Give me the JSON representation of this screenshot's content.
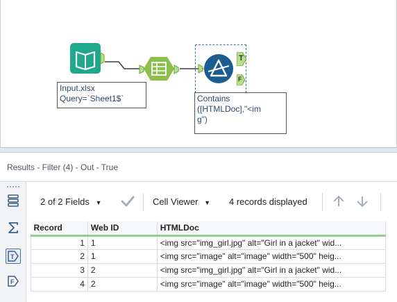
{
  "canvas": {
    "input_tool": {
      "icon": "book-input-icon",
      "annotation_line1": "Input.xlsx",
      "annotation_line2": "Query=`Sheet1$`"
    },
    "select_tool": {
      "icon": "table-select-icon"
    },
    "filter_tool": {
      "icon": "filter-triangle-icon",
      "true_anchor": "T",
      "false_anchor": "F",
      "annotation_line1": "Contains",
      "annotation_line2": "([HTMLDoc],\"<im",
      "annotation_line3": "g\")"
    }
  },
  "results": {
    "title": "Results - Filter (4) - Out - True",
    "toolbar": {
      "fields_label": "2 of 2 Fields",
      "viewer_label": "Cell Viewer",
      "records_label": "4 records displayed"
    },
    "rail": [
      "fields-list-icon",
      "sum-icon",
      "true-anchor-icon",
      "false-anchor-icon"
    ],
    "columns": [
      "Record",
      "Web ID",
      "HTMLDoc"
    ],
    "rows": [
      {
        "record": "1",
        "web_id": "1",
        "html": "<img src=\"img_girl.jpg\" alt=\"Girl in a jacket\" wid..."
      },
      {
        "record": "2",
        "web_id": "1",
        "html": "<img src=\"image\" alt=\"image\" width=\"500\" heig..."
      },
      {
        "record": "3",
        "web_id": "2",
        "html": "<img src=\"img_girl.jpg\" alt=\"Girl in a jacket\" wid..."
      },
      {
        "record": "4",
        "web_id": "2",
        "html": "<img src=\"image\" alt=\"image\" width=\"500\" heig..."
      }
    ]
  },
  "colors": {
    "input_green": "#1fa88a",
    "select_green": "#8cc04b",
    "filter_blue": "#1b5d8f",
    "anchor_green": "#b6e08a",
    "header_underline": "#8fd18b"
  }
}
